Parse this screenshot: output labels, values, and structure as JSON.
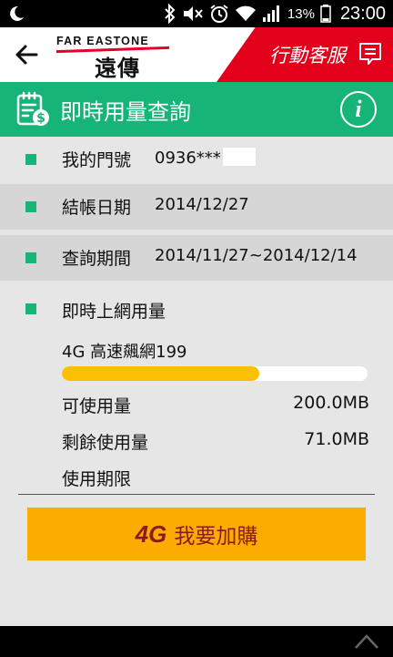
{
  "status_bar": {
    "battery_percent": "13%",
    "time": "23:00"
  },
  "header": {
    "logo_en": "FAR EASTONE",
    "logo_zh": "遠傳",
    "service_label": "行動客服"
  },
  "title_bar": {
    "title": "即時用量查詢",
    "info_glyph": "i"
  },
  "details": {
    "phone_label": "我的門號",
    "phone_value": "0936***",
    "billing_label": "結帳日期",
    "billing_value": "2014/12/27",
    "period_label": "查詢期間",
    "period_value": "2014/11/27~2014/12/14"
  },
  "usage": {
    "section_title": "即時上網用量",
    "plan_name": "4G 高速飆網199",
    "used_fraction": 0.645,
    "available_label": "可使用量",
    "available_value": "200.0MB",
    "remaining_label": "剩餘使用量",
    "remaining_value": "71.0MB",
    "period_label": "使用期限"
  },
  "buy_button": {
    "badge": "4G",
    "label": "我要加購"
  },
  "colors": {
    "accent_green": "#16b577",
    "brand_red": "#e2001a",
    "progress_yellow": "#fcc000",
    "button_orange": "#fcab00"
  }
}
